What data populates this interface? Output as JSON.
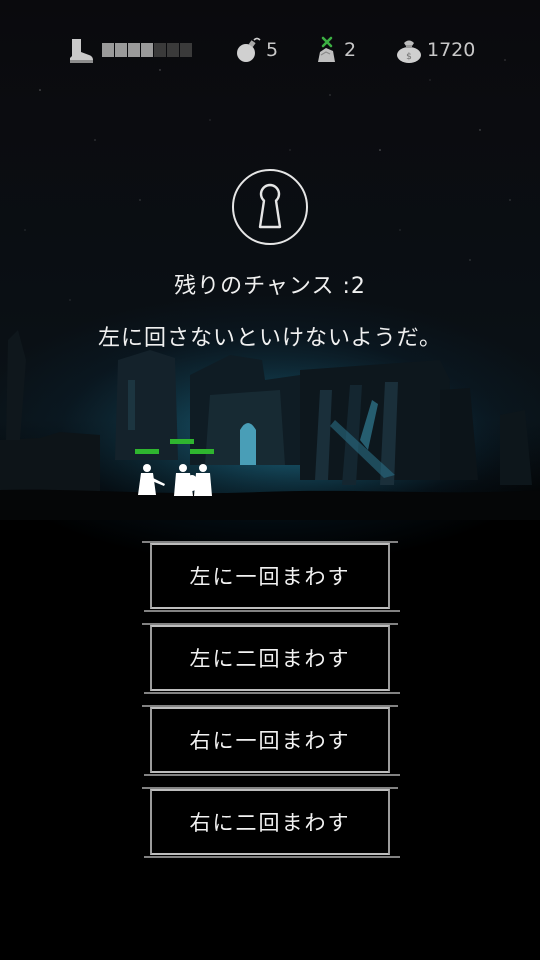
{
  "hud": {
    "stamina": {
      "filled": 4,
      "total": 7
    },
    "bombs": "5",
    "ore": "2",
    "money": "1720"
  },
  "icons": {
    "stamina": "boot-icon",
    "bombs": "bomb-icon",
    "ore": "ore-pickaxe-icon",
    "money": "money-bag-icon",
    "lock": "keyhole-icon"
  },
  "puzzle": {
    "chance_text": "残りのチャンス :2",
    "message": "左に回さないといけないようだ。"
  },
  "choices": [
    {
      "label": "左に一回まわす"
    },
    {
      "label": "左に二回まわす"
    },
    {
      "label": "右に一回まわす"
    },
    {
      "label": "右に二回まわす"
    }
  ],
  "colors": {
    "health_bar": "#2fb52f",
    "glow": "#1e7896"
  }
}
